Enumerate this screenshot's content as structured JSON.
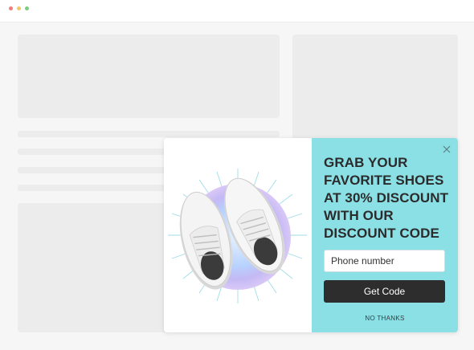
{
  "popup": {
    "headline_lines": [
      "GRAB YOUR",
      "FAVORITE SHOES",
      "AT 30% DISCOUNT",
      "WITH OUR",
      "DISCOUNT CODE"
    ],
    "phone_placeholder": "Phone number",
    "submit_label": "Get Code",
    "dismiss_label": "NO THANKS",
    "close_icon": "close-icon",
    "image_subject": "white-sneakers-image"
  },
  "colors": {
    "popup_panel": "#8be0e6",
    "button_bg": "#2d2d2d",
    "placeholder_blocks": "#ececec"
  }
}
